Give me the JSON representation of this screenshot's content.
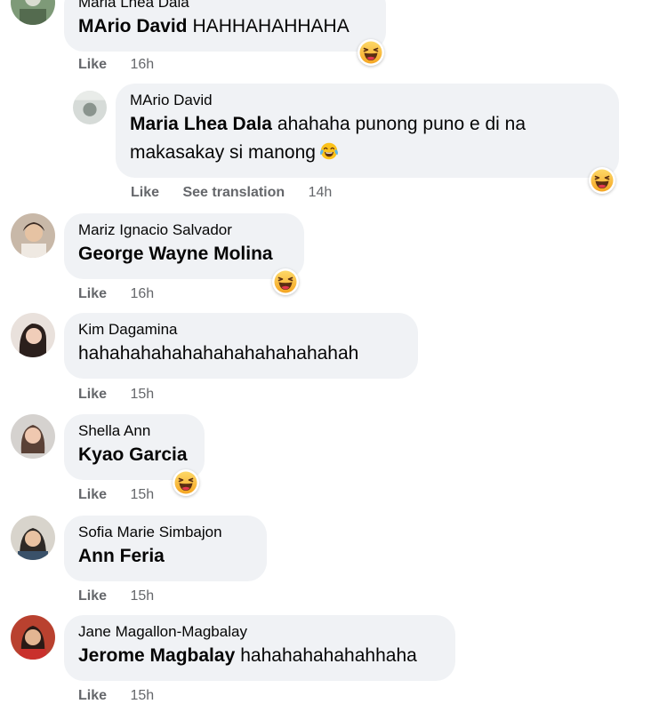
{
  "comments": [
    {
      "author": "Maria Lhea Dala",
      "tag": "MArio David",
      "text": "HAHHAHAHHAHA",
      "like": "Like",
      "time": "16h",
      "reaction": "haha-icon"
    },
    {
      "author": "MArio David",
      "tag": "Maria Lhea Dala",
      "text_line1": "ahahaha punong puno e di na",
      "text_line2": "makasakay si manong",
      "like": "Like",
      "translate": "See translation",
      "time": "14h",
      "reaction": "haha-icon",
      "inline_emoji": "tears-of-joy-emoji"
    },
    {
      "author": "Mariz Ignacio Salvador",
      "tag": "George Wayne Molina",
      "text": "",
      "like": "Like",
      "time": "16h",
      "reaction": "haha-icon"
    },
    {
      "author": "Kim Dagamina",
      "text": "hahahahahahahahahahahahahah",
      "like": "Like",
      "time": "15h"
    },
    {
      "author": "Shella Ann",
      "tag": "Kyao Garcia",
      "text": "",
      "like": "Like",
      "time": "15h",
      "reaction": "haha-icon"
    },
    {
      "author": "Sofia Marie Simbajon",
      "tag": "Ann Feria",
      "text": "",
      "like": "Like",
      "time": "15h"
    },
    {
      "author": "Jane Magallon-Magbalay",
      "tag": "Jerome Magbalay",
      "text": "hahahahahahahhaha",
      "like": "Like",
      "time": "15h"
    }
  ],
  "colors": {
    "bubble": "#f0f2f5",
    "meta_text": "#65676b",
    "haha_yellow": "#f7b125",
    "haha_mouth": "#5a2f12",
    "haha_tongue": "#e3374f"
  }
}
